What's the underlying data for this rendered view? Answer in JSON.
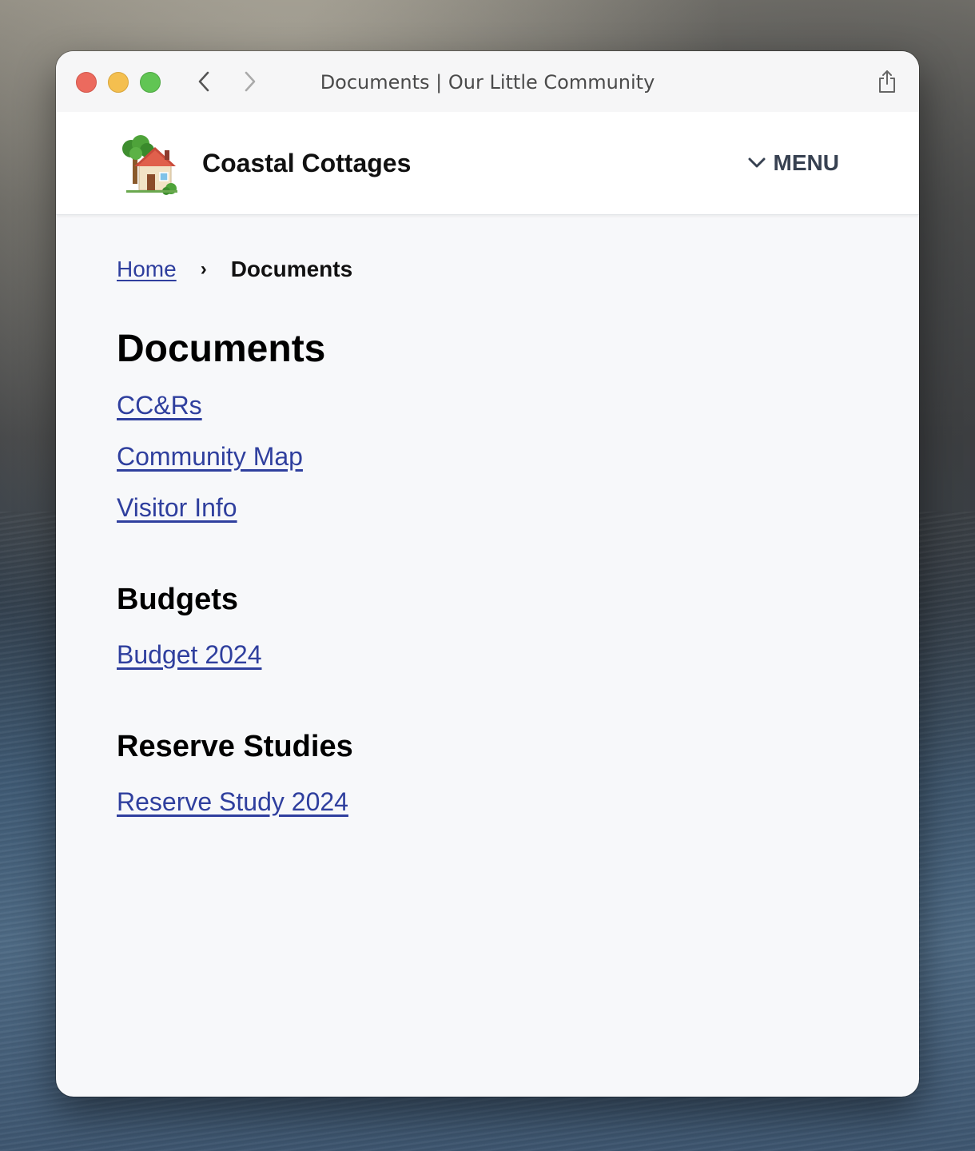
{
  "browser": {
    "window_title": "Documents | Our Little Community"
  },
  "header": {
    "site_name": "Coastal Cottages",
    "logo_icon": "house-with-garden-icon",
    "menu_label": "MENU"
  },
  "breadcrumb": {
    "home_label": "Home",
    "separator": "›",
    "current_label": "Documents"
  },
  "main": {
    "title": "Documents",
    "documents": [
      "CC&Rs",
      "Community Map",
      "Visitor Info"
    ],
    "sections": [
      {
        "title": "Budgets",
        "links": [
          "Budget 2024"
        ]
      },
      {
        "title": "Reserve Studies",
        "links": [
          "Reserve Study 2024"
        ]
      }
    ]
  },
  "colors": {
    "link": "#2f3f9e",
    "page_background": "#f7f8fa",
    "header_background": "#ffffff",
    "menu_text": "#374151"
  }
}
